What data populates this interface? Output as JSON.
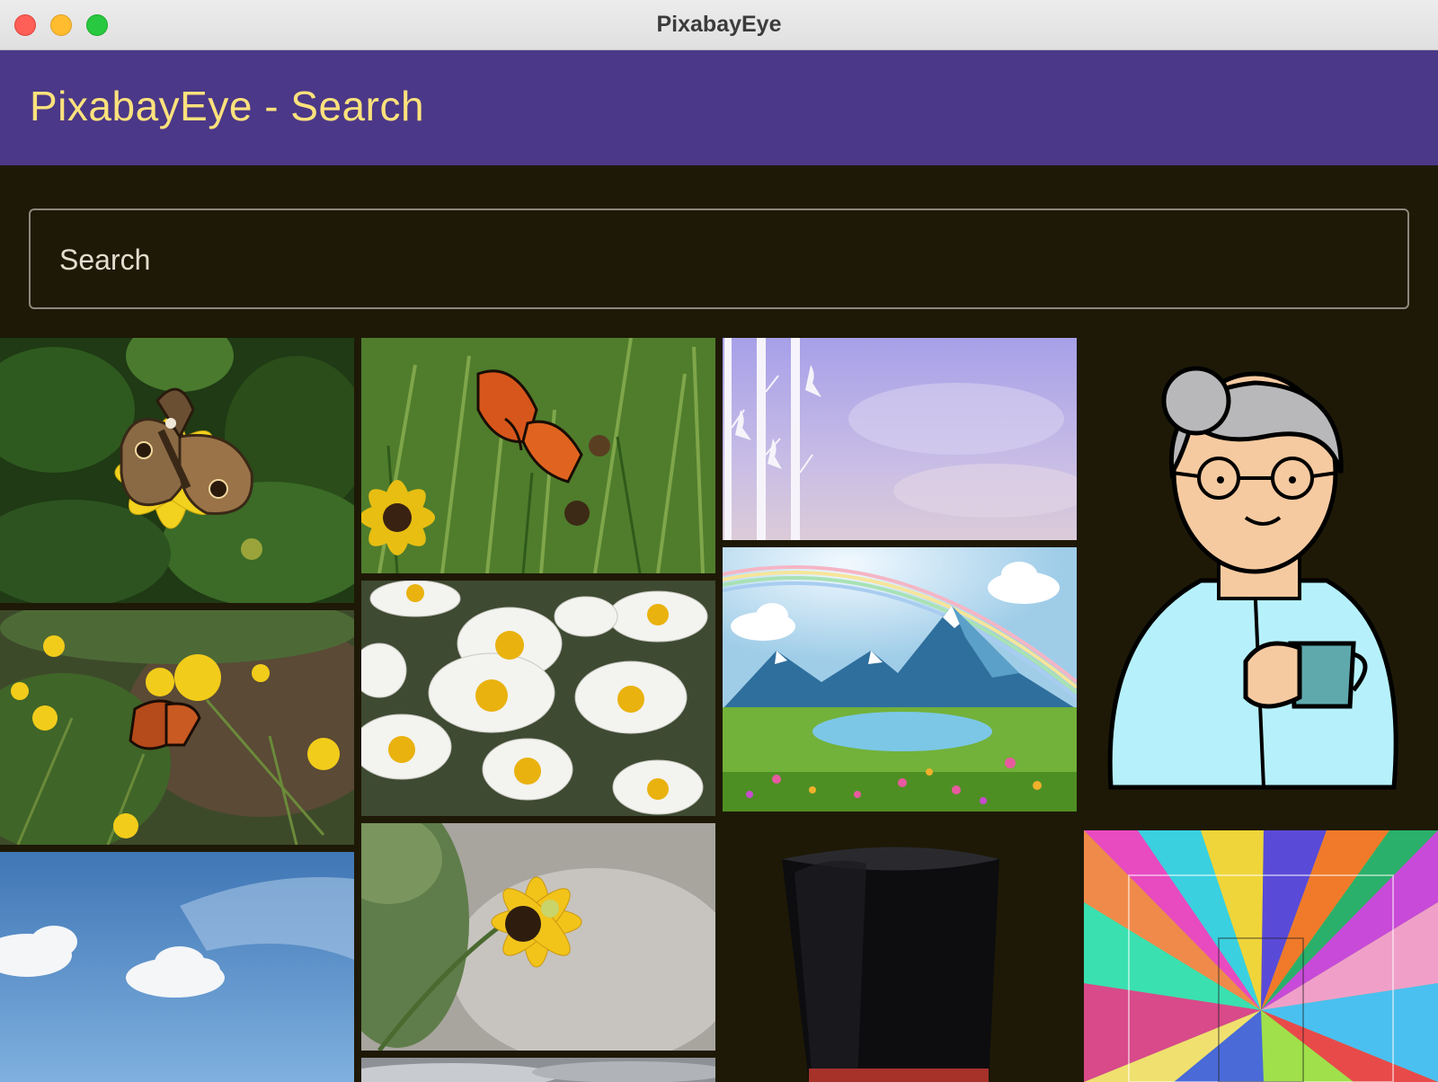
{
  "window": {
    "title": "PixabayEye"
  },
  "appbar": {
    "title": "PixabayEye - Search"
  },
  "search": {
    "placeholder": "Search",
    "value": ""
  },
  "images": [
    {
      "subject": "butterfly on yellow flower",
      "icon": "butterfly-photo"
    },
    {
      "subject": "butterfly on yellow flower among weeds",
      "icon": "butterfly-photo"
    },
    {
      "subject": "blue sky with clouds",
      "icon": "sky-photo"
    },
    {
      "subject": "orange butterfly on black-eyed susan",
      "icon": "butterfly-photo"
    },
    {
      "subject": "white daisies",
      "icon": "daisy-photo"
    },
    {
      "subject": "yellow flower close-up",
      "icon": "flower-photo"
    },
    {
      "subject": "cloudy sky",
      "icon": "sky-photo"
    },
    {
      "subject": "birch trees with birds on purple sky",
      "icon": "illustration"
    },
    {
      "subject": "mountain lake with rainbow",
      "icon": "illustration"
    },
    {
      "subject": "black top hat",
      "icon": "hat-illustration"
    },
    {
      "subject": "grandmother holding a mug",
      "icon": "cartoon-illustration"
    },
    {
      "subject": "colorful triangle mosaic",
      "icon": "abstract-illustration"
    }
  ],
  "colors": {
    "appbar": "#4b3888",
    "appbar_text": "#fde27c",
    "background": "#1e1906",
    "search_border": "#8c887c"
  }
}
